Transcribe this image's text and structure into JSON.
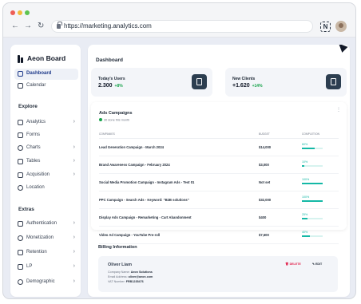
{
  "browser": {
    "url": "https://marketing.analytics.com",
    "extension_letter": "N",
    "traffic_lights": [
      "#ee5e56",
      "#f2bb3a",
      "#5ec450"
    ]
  },
  "sidebar": {
    "brand": "Aeon Board",
    "top_items": [
      {
        "label": "Dashboard",
        "icon": "home-icon",
        "active": true
      },
      {
        "label": "Calendar",
        "icon": "calendar-icon"
      }
    ],
    "explore_title": "Explore",
    "explore_items": [
      {
        "label": "Analytics",
        "icon": "analytics-icon",
        "chevron": true
      },
      {
        "label": "Forms",
        "icon": "forms-icon"
      },
      {
        "label": "Charts",
        "icon": "chart-icon",
        "chevron": true
      },
      {
        "label": "Tables",
        "icon": "table-icon",
        "chevron": true
      },
      {
        "label": "Acquisition",
        "icon": "acquisition-icon",
        "chevron": true
      },
      {
        "label": "Location",
        "icon": "location-icon"
      }
    ],
    "extras_title": "Extras",
    "extras_items": [
      {
        "label": "Authentication",
        "icon": "authentication-icon",
        "chevron": true
      },
      {
        "label": "Monetization",
        "icon": "monetization-icon",
        "chevron": true
      },
      {
        "label": "Retention",
        "icon": "retention-icon",
        "chevron": true
      },
      {
        "label": "LP",
        "icon": "lp-icon",
        "chevron": true
      },
      {
        "label": "Demographic",
        "icon": "demographic-icon",
        "chevron": true
      }
    ]
  },
  "dashboard": {
    "title": "Dashboard",
    "stats": [
      {
        "label": "Today's Users",
        "value": "2.300",
        "delta": "+8%",
        "icon": "users-icon"
      },
      {
        "label": "New Clients",
        "value": "+1.620",
        "delta": "+14%",
        "icon": "document-icon"
      }
    ]
  },
  "ads": {
    "title": "Ads Campaigns",
    "subtitle": "30 done this month",
    "columns": [
      "COMPANIES",
      "BUDGET",
      "COMPLETION"
    ],
    "rows": [
      {
        "name": "Lead Generation Campaign - March 2024",
        "budget": "$14,000",
        "completion": "60%",
        "pct": 60
      },
      {
        "name": "Brand Awareness Campaign - February 2024",
        "budget": "$3,000",
        "completion": "10%",
        "pct": 10
      },
      {
        "name": "Social Media Promotion Campaign - Instagram Ads - Test 01",
        "budget": "Not set",
        "completion": "100%",
        "pct": 100
      },
      {
        "name": "PPC Campaign - Search Ads - Keyword: \"B2B solutions\"",
        "budget": "$32,000",
        "completion": "100%",
        "pct": 100
      },
      {
        "name": "Display Ads Campaign - Remarketing - Cart Abandonment",
        "budget": "$400",
        "completion": "25%",
        "pct": 25
      },
      {
        "name": "Video Ad Campaign - YouTube Pre-roll",
        "budget": "$7,600",
        "completion": "40%",
        "pct": 40
      }
    ]
  },
  "billing": {
    "title": "Billing Information",
    "name": "Oliver Liam",
    "company_label": "Company Name:",
    "company": "Aeon Solutions",
    "email_label": "Email Address:",
    "email": "oliver@aeon.com",
    "vat_label": "VAT Number:",
    "vat": "FRB1235476",
    "delete_label": "DELETE",
    "edit_label": "EDIT"
  },
  "colors": {
    "accent": "#2c3e50",
    "success": "#16a34a",
    "progress": "#14b8a6",
    "danger": "#e11d48"
  }
}
